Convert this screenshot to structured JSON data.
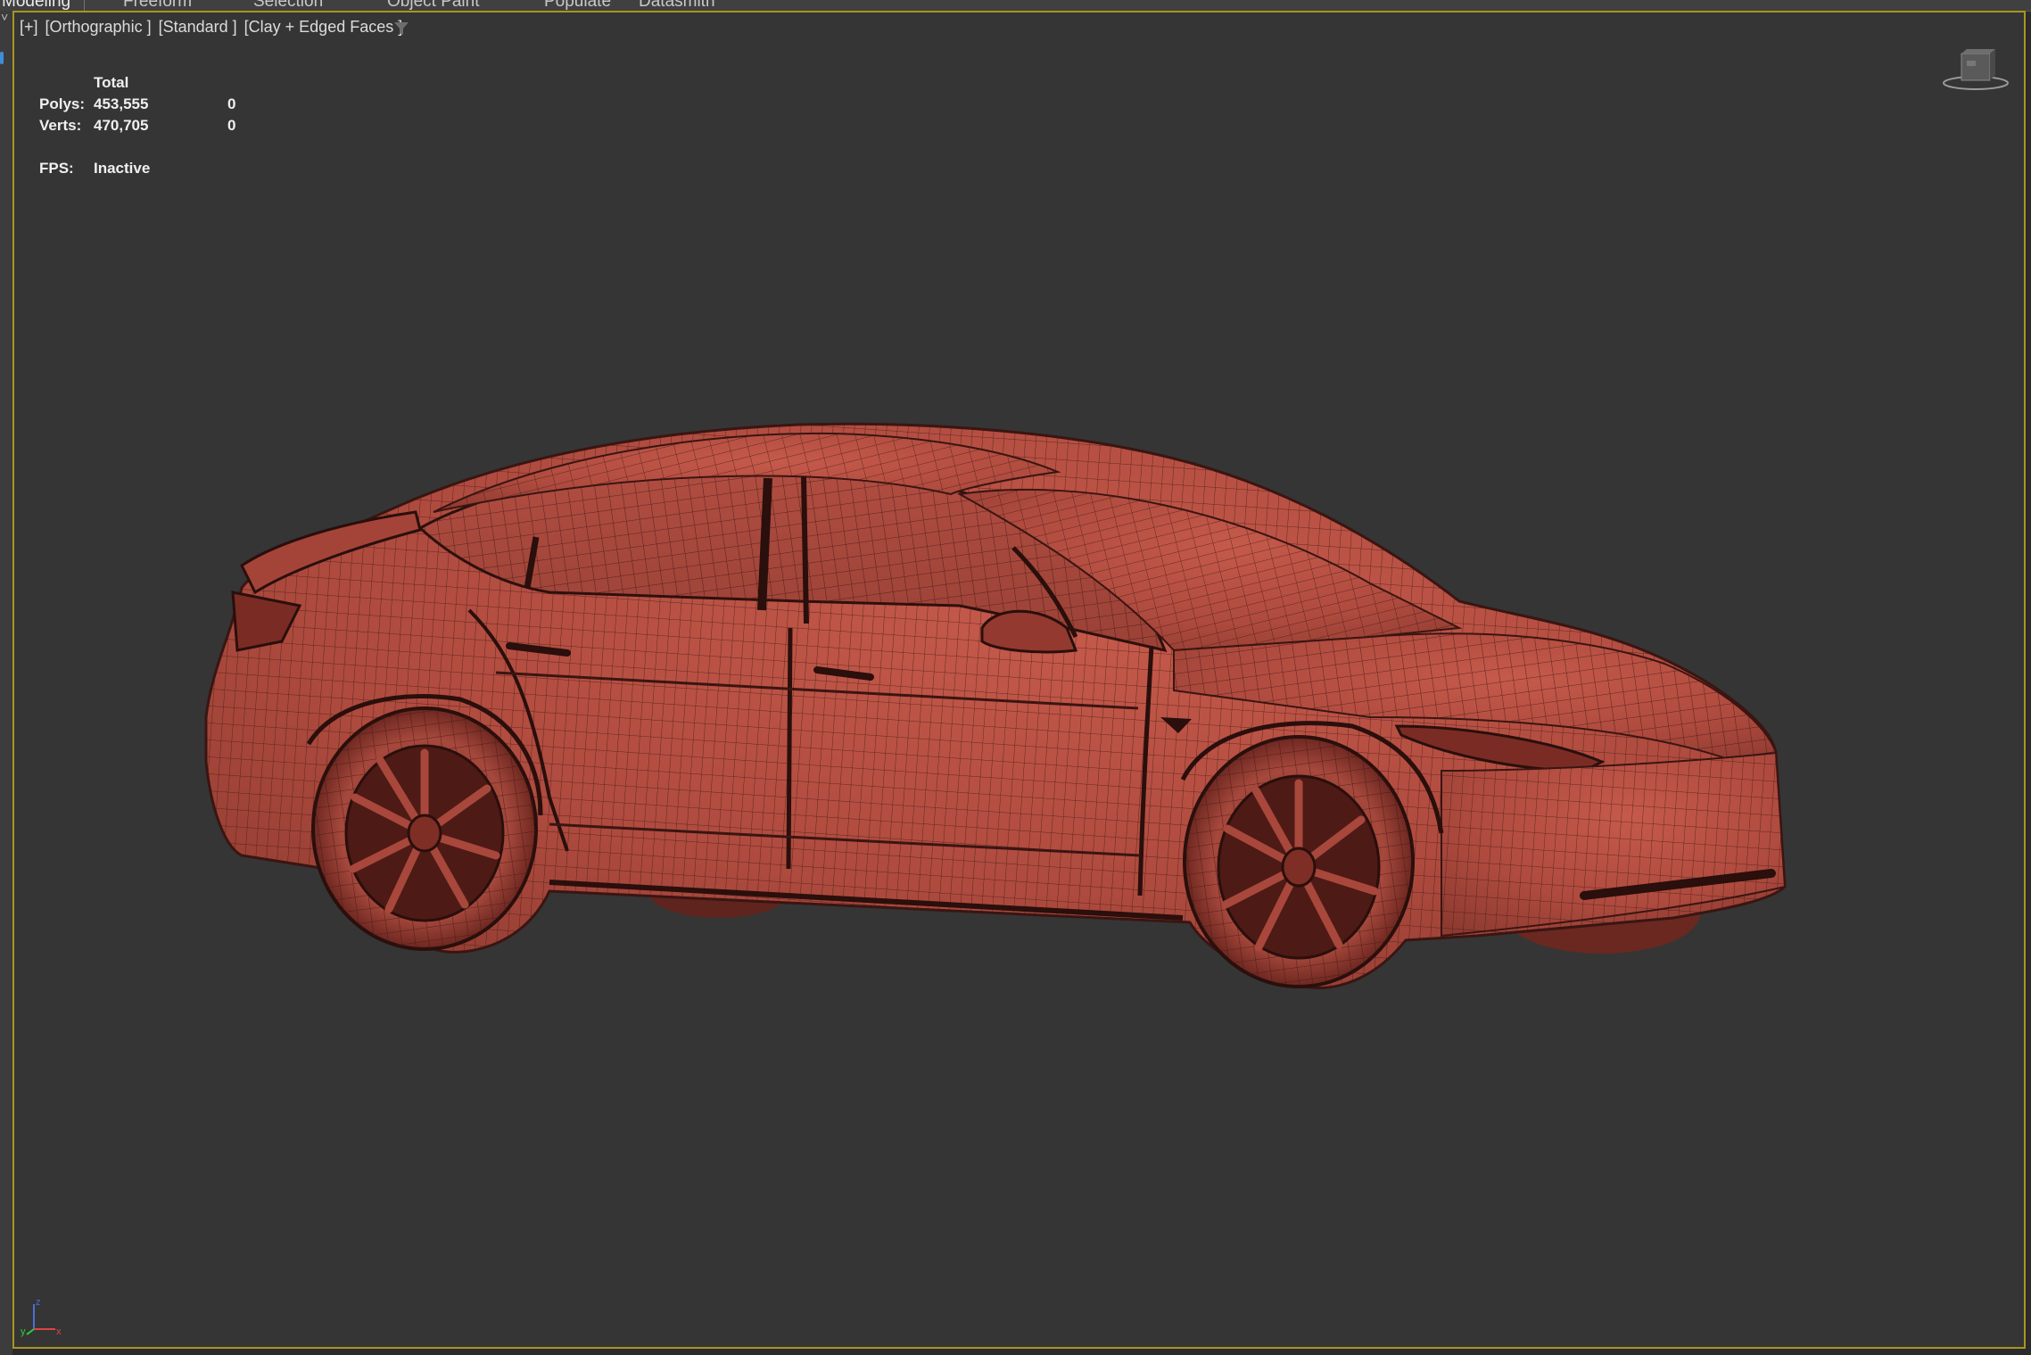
{
  "ribbon": {
    "tabs": [
      {
        "label": "Modeling",
        "active": true
      },
      {
        "label": "Freeform",
        "active": false
      },
      {
        "label": "Selection",
        "active": false
      },
      {
        "label": "Object Paint",
        "active": false
      },
      {
        "label": "Populate",
        "active": false
      },
      {
        "label": "Datasmith",
        "active": false
      }
    ]
  },
  "viewport": {
    "label": {
      "plus": "[+]",
      "projection": "[Orthographic ]",
      "shading_mode": "[Standard ]",
      "render_style": "[Clay + Edged Faces ]"
    },
    "stats": {
      "header": "Total",
      "polys_label": "Polys:",
      "polys_total": "453,555",
      "polys_selected": "0",
      "verts_label": "Verts:",
      "verts_total": "470,705",
      "verts_selected": "0",
      "fps_label": "FPS:",
      "fps_value": "Inactive"
    },
    "axis": {
      "x": "x",
      "y": "y",
      "z": "z"
    },
    "active_border_color": "#a8951f",
    "model_color": "#b24c40",
    "wire_color": "#3a1512",
    "icons": [
      "filter-icon",
      "viewcube-icon",
      "axis-tripod-icon"
    ]
  }
}
